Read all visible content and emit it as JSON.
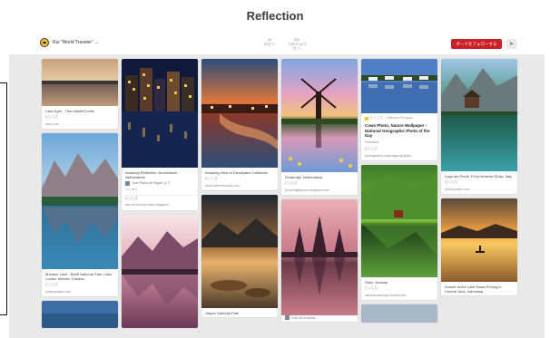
{
  "page": {
    "title": "Reflection"
  },
  "header": {
    "owner_name": "Rui \"World Traveler\" ...",
    "stats": [
      {
        "count": "30",
        "label": "のピン"
      },
      {
        "count": "320",
        "label": "人のフォロワ ー"
      }
    ],
    "follow_label": "ボードをフォローする"
  },
  "pins": {
    "lake_eyre": {
      "desc": "Lake Eyre - Theo Allofs/Corbis",
      "save": "ピンした",
      "source": "mao.com"
    },
    "moraine": {
      "desc": "Moraine Lake - Banff National Park, Lake Louise, Alberta, Canada",
      "save": "ピンした",
      "source": "pinspopulars.com"
    },
    "amsterdam": {
      "desc": "Amazing Reflection, Amsterdam Netherlands",
      "credit": "Juan Pablo de Miguel より",
      "likes": "1 い ♥ 4",
      "save": "ピンした",
      "source": "aterveli-korean-stars.blogspot..."
    },
    "disneyland": {
      "desc": "Amazing View of Disneyland California",
      "save": "ピンした",
      "source": "travel-afternoontalk.com"
    },
    "jasper": {
      "desc": "Jasper National Park"
    },
    "kinderdijk": {
      "desc": "Kinderdijk, Netherlands",
      "save": "ピンした",
      "source": "jenusmightyourn.blogspot.com"
    },
    "temple": {
      "desc": "Fine Art America"
    },
    "cows": {
      "src_label": "ピンした ...National Geograp...",
      "desc": "Cows Photo, Nature Wallpaper - National Geographic Photo of the Day",
      "meta": "Friesland",
      "save": "ピンした",
      "source": "photography.nationalgeographic..."
    },
    "stryn": {
      "desc": "Stryn, Norway",
      "save": "ピンした",
      "source": "wanderlustscape.tumblr.com"
    },
    "lago_preit": {
      "desc": "Lago dei Predil, Friuli-Venezia Giulia, Italy",
      "save": "ピンした",
      "source": "erstacpoffee.com"
    },
    "rawa_pening": {
      "desc": "Sunset at the Lake Rawa Pening in Central Java, Indonesia."
    }
  },
  "colors": {
    "follow_button": "#cb2027",
    "board_background": "#e9e9e9",
    "page_background": "#ffffff"
  }
}
